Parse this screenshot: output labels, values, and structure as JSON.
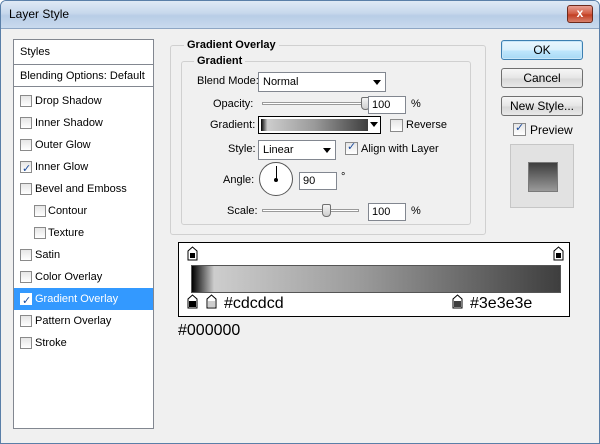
{
  "window": {
    "title": "Layer Style",
    "close_label": "x"
  },
  "styles_panel": {
    "header": "Styles",
    "blending": "Blending Options: Default",
    "items": [
      {
        "label": "Drop Shadow",
        "checked": false,
        "sub": false
      },
      {
        "label": "Inner Shadow",
        "checked": false,
        "sub": false
      },
      {
        "label": "Outer Glow",
        "checked": false,
        "sub": false
      },
      {
        "label": "Inner Glow",
        "checked": true,
        "sub": false
      },
      {
        "label": "Bevel and Emboss",
        "checked": false,
        "sub": false
      },
      {
        "label": "Contour",
        "checked": false,
        "sub": true
      },
      {
        "label": "Texture",
        "checked": false,
        "sub": true
      },
      {
        "label": "Satin",
        "checked": false,
        "sub": false
      },
      {
        "label": "Color Overlay",
        "checked": false,
        "sub": false
      },
      {
        "label": "Gradient Overlay",
        "checked": true,
        "sub": false,
        "selected": true
      },
      {
        "label": "Pattern Overlay",
        "checked": false,
        "sub": false
      },
      {
        "label": "Stroke",
        "checked": false,
        "sub": false
      }
    ]
  },
  "gradient_overlay": {
    "title": "Gradient Overlay",
    "section": "Gradient",
    "blend_mode_label": "Blend Mode:",
    "blend_mode_value": "Normal",
    "opacity_label": "Opacity:",
    "opacity_value": "100",
    "opacity_unit": "%",
    "opacity_fraction": 1.0,
    "gradient_label": "Gradient:",
    "reverse_label": "Reverse",
    "reverse_checked": false,
    "style_label": "Style:",
    "style_value": "Linear",
    "align_label": "Align with Layer",
    "align_checked": true,
    "angle_label": "Angle:",
    "angle_value": "90",
    "angle_unit": "°",
    "scale_label": "Scale:",
    "scale_value": "100",
    "scale_unit": "%",
    "scale_fraction": 0.667
  },
  "buttons": {
    "ok": "OK",
    "cancel": "Cancel",
    "new_style": "New Style...",
    "preview_label": "Preview",
    "preview_checked": true
  },
  "gradient_editor": {
    "stops": [
      {
        "label": "#000000",
        "color": "#000000"
      },
      {
        "label": "#cdcdcd",
        "color": "#cdcdcd"
      },
      {
        "label": "#3e3e3e",
        "color": "#3e3e3e"
      }
    ]
  },
  "colors": {
    "selection": "#3399ff",
    "title_bar": "#c7d8ec",
    "close_button": "#c13d22"
  }
}
